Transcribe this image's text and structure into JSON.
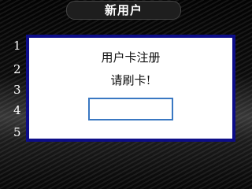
{
  "header": {
    "title": "新用户"
  },
  "list": {
    "numbers": [
      "1",
      "2",
      "3",
      "4",
      "5"
    ]
  },
  "dialog": {
    "title": "用户卡注册",
    "message": "请刷卡!",
    "input_value": "",
    "border_color": "#0d0d88",
    "input_border_color": "#3a78c2"
  }
}
